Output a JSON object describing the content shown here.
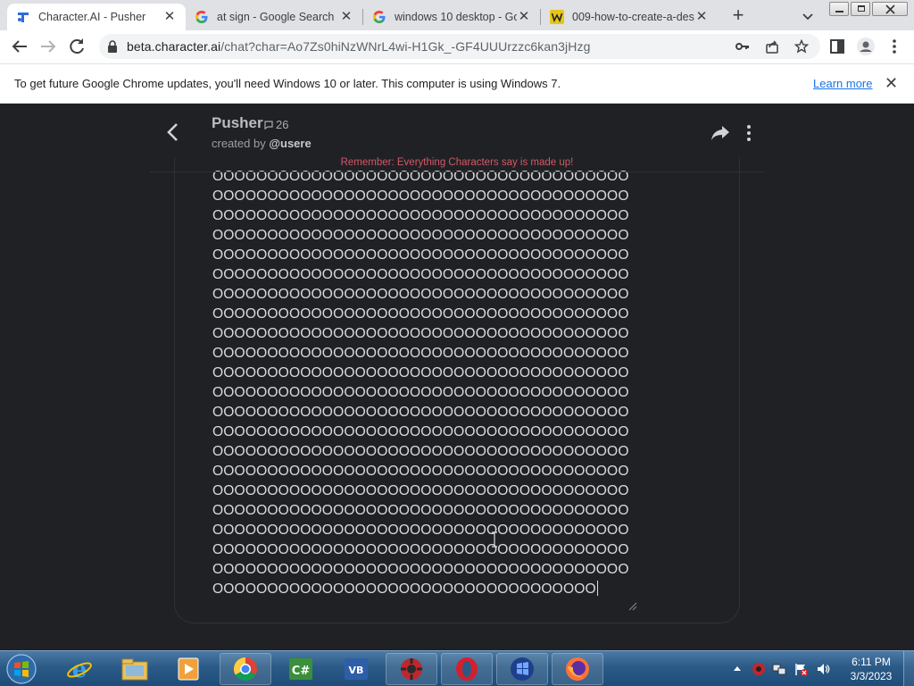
{
  "browser": {
    "tabs": [
      {
        "title": "Character.AI - Pusher",
        "favicon": "character-ai-icon",
        "active": true
      },
      {
        "title": "at sign - Google Search",
        "favicon": "google-icon",
        "active": false
      },
      {
        "title": "windows 10 desktop - Go",
        "favicon": "google-icon",
        "active": false
      },
      {
        "title": "009-how-to-create-a-des",
        "favicon": "wikihow-icon",
        "active": false
      }
    ],
    "url_host": "beta.character.ai",
    "url_path": "/chat?char=Ao7Zs0hiNzWNrL4wi-H1Gk_-GF4UUUrzzc6kan3jHzg"
  },
  "infobar": {
    "message": "To get future Google Chrome updates, you'll need Windows 10 or later. This computer is using Windows 7.",
    "link": "Learn more"
  },
  "chat": {
    "character_name": "Pusher",
    "chat_count": "26",
    "created_by_prefix": "created by",
    "creator": "@usere",
    "disclaimer": "Remember: Everything Characters say is made up!",
    "input_text": "OOOOOOOOOOOOOOOOOOOOOOOOOOOOOOOOOOOOOOOOOOOOOOOOOOOOOOOOOOOOOOOOOOOOOOOOOOOOOOOOOOOOOOOOOOOOOOOOOOOOOOOOOOOOOOOOOOOOOOOOOOOOOOOOOOOOOOOOOOOOOOOOOOOOOOOOOOOOOOOOOOOOOOOOOOOOOOOOOOOOOOOOOOOOOOOOOOOOOOOOOOOOOOOOOOOOOOOOOOOOOOOOOOOOOOOOOOOOOOOOOOOOOOOOOOOOOOOOOOOOOOOOOOOOOOOOOOOOOOOOOOOOOOOOOOOOOOOOOOOOOOOOOOOOOOOOOOOOOOOOOOOOOOOOOOOOOOOOOOOOOOOOOOOOOOOOOOOOOOOOOOOOOOOOOOOOOOOOOOOOOOOOOOOOOOOOOOOOOOOOOOOOOOOOOOOOOOOOOOOOOOOOOOOOOOOOOOOOOOOOOOOOOOOOOOOOOOOOOOOOOOOOOOOOOOOOOOOOOOOOOOOOOOOOOOOOOOOOOOOOOOOOOOOOOOOOOOOOOOOOOOOOOOOOOOOOOOOOOOOOOOOOOOOOOOOOOOOOOOOOOOOOOOOOOOOOOOOOOOOOOOOOOOOOOOOOOOOOOOOOOOOOOOOOOOOOOOOOOOOOOOOOOOOOOOOOOOOOOOOOOOOOOOOOOOOOOOOOOOOOOOOOOOOOOOOOOOOOOOOOOOOOOOOOOOOOOOOOOOOOOOOOOOOOOOOOOOOOOOOOOOOOOOOOOOOOOOOOOOOOOOOOOOOOOOOOOOOOOOOOOOOOOOOOOOOOOOOOOOOOOOOOOOOOOOOOOOOOOOOOOOOOOOOOOOOOOOOOOOOOOOOOOOOOOOOOO"
  },
  "taskbar": {
    "apps": [
      {
        "name": "internet-explorer-icon"
      },
      {
        "name": "file-explorer-icon"
      },
      {
        "name": "media-player-icon"
      },
      {
        "name": "chrome-icon"
      },
      {
        "name": "csharp-icon"
      },
      {
        "name": "visual-basic-icon"
      },
      {
        "name": "red-gear-app-icon"
      },
      {
        "name": "opera-icon"
      },
      {
        "name": "blue-app-icon"
      },
      {
        "name": "firefox-icon"
      }
    ],
    "time": "6:11 PM",
    "date": "3/3/2023"
  },
  "colors": {
    "page_bg": "#202124",
    "disclaimer": "#d35869",
    "link": "#1a73e8"
  }
}
